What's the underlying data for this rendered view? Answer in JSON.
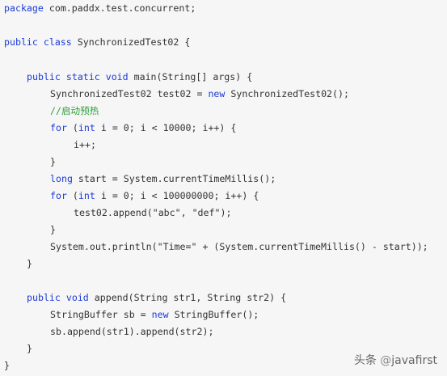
{
  "code": {
    "lines": [
      {
        "indent": 0,
        "tokens": [
          {
            "t": "package",
            "k": "kw"
          },
          {
            "t": " com.paddx.test.concurrent;"
          }
        ]
      },
      {
        "indent": 0,
        "tokens": []
      },
      {
        "indent": 0,
        "tokens": [
          {
            "t": "public class",
            "k": "kw"
          },
          {
            "t": " SynchronizedTest02 {"
          }
        ]
      },
      {
        "indent": 0,
        "tokens": []
      },
      {
        "indent": 1,
        "tokens": [
          {
            "t": "public static void",
            "k": "kw"
          },
          {
            "t": " main(String[] args) {"
          }
        ]
      },
      {
        "indent": 2,
        "tokens": [
          {
            "t": "SynchronizedTest02 test02 = "
          },
          {
            "t": "new",
            "k": "kw"
          },
          {
            "t": " SynchronizedTest02();"
          }
        ]
      },
      {
        "indent": 2,
        "tokens": [
          {
            "t": "//启动预热",
            "k": "cm"
          }
        ]
      },
      {
        "indent": 2,
        "tokens": [
          {
            "t": "for",
            "k": "kw"
          },
          {
            "t": " ("
          },
          {
            "t": "int",
            "k": "kw"
          },
          {
            "t": " i = 0; i < 10000; i++) {"
          }
        ]
      },
      {
        "indent": 3,
        "tokens": [
          {
            "t": "i++;"
          }
        ]
      },
      {
        "indent": 2,
        "tokens": [
          {
            "t": "}"
          }
        ]
      },
      {
        "indent": 2,
        "tokens": [
          {
            "t": "long",
            "k": "kw"
          },
          {
            "t": " start = System.currentTimeMillis();"
          }
        ]
      },
      {
        "indent": 2,
        "tokens": [
          {
            "t": "for",
            "k": "kw"
          },
          {
            "t": " ("
          },
          {
            "t": "int",
            "k": "kw"
          },
          {
            "t": " i = 0; i < 100000000; i++) {"
          }
        ]
      },
      {
        "indent": 3,
        "tokens": [
          {
            "t": "test02.append(\"abc\", \"def\");"
          }
        ]
      },
      {
        "indent": 2,
        "tokens": [
          {
            "t": "}"
          }
        ]
      },
      {
        "indent": 2,
        "tokens": [
          {
            "t": "System.out.println(\"Time=\" + (System.currentTimeMillis() - start));"
          }
        ]
      },
      {
        "indent": 1,
        "tokens": [
          {
            "t": "}"
          }
        ]
      },
      {
        "indent": 0,
        "tokens": []
      },
      {
        "indent": 1,
        "tokens": [
          {
            "t": "public void",
            "k": "kw"
          },
          {
            "t": " append(String str1, String str2) {"
          }
        ]
      },
      {
        "indent": 2,
        "tokens": [
          {
            "t": "StringBuffer sb = "
          },
          {
            "t": "new",
            "k": "kw"
          },
          {
            "t": " StringBuffer();"
          }
        ]
      },
      {
        "indent": 2,
        "tokens": [
          {
            "t": "sb.append(str1).append(str2);"
          }
        ]
      },
      {
        "indent": 1,
        "tokens": [
          {
            "t": "}"
          }
        ]
      },
      {
        "indent": 0,
        "tokens": [
          {
            "t": "}"
          }
        ]
      }
    ]
  },
  "watermark": {
    "prefix": "头条",
    "separator": " @",
    "handle": "javafirst"
  },
  "colors": {
    "background": "#f6f6f6",
    "keyword": "#1d3bd6",
    "comment": "#2f9e3f",
    "text": "#333333"
  }
}
